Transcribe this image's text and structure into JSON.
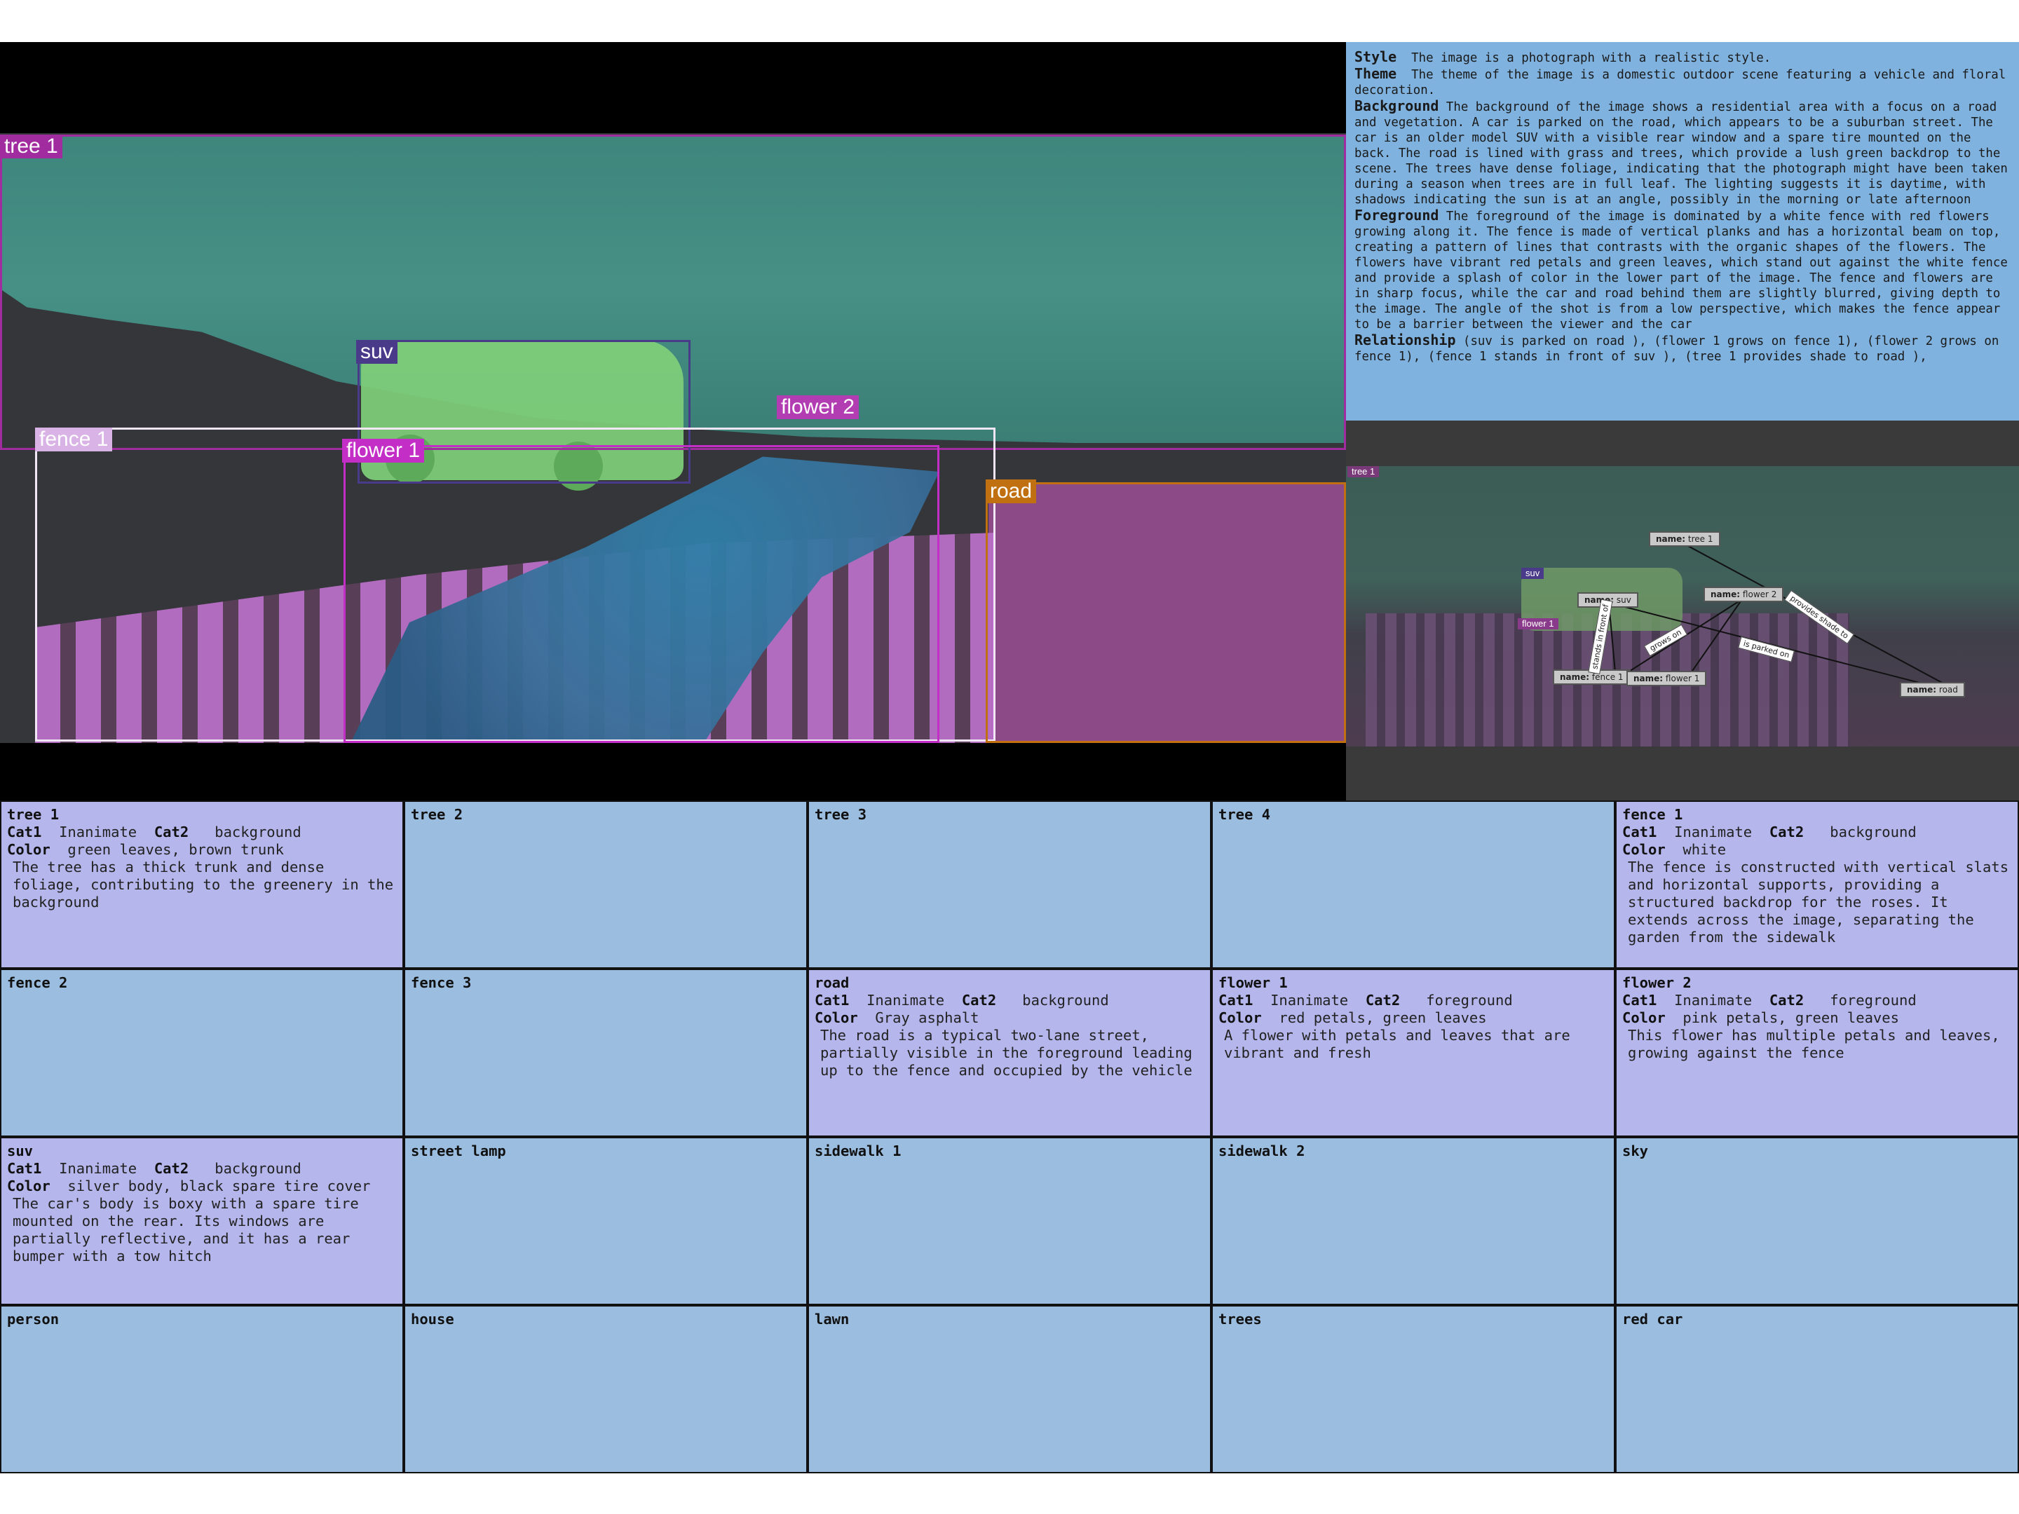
{
  "scene": {
    "labels": {
      "tree1": "tree 1",
      "suv": "suv",
      "flower2": "flower 2",
      "fence1": "fence 1",
      "flower1": "flower 1",
      "road": "road"
    },
    "colors": {
      "tree": "#1c8a78",
      "suv": "#4a3a8a",
      "flower2": "#b23cb2",
      "fence": "#ffffff",
      "flower1": "#c32ec6",
      "road": "#c07010"
    }
  },
  "description": {
    "style_key": "Style",
    "style": "The image is a photograph with a realistic style.",
    "theme_key": "Theme",
    "theme": "The theme of the image is a domestic outdoor scene featuring a vehicle and floral decoration.",
    "background_key": "Background",
    "background": "The background of the image shows a residential area with a focus on a road and vegetation. A car is parked on the road, which appears to be a suburban street. The car is an older model SUV with a visible rear window and a spare tire mounted on the back. The road is lined with grass and trees, which provide a lush green backdrop to the scene. The trees have dense foliage, indicating that the photograph might have been taken during a season when trees are in full leaf. The lighting suggests it is daytime, with shadows indicating the sun is at an angle, possibly in the morning or late afternoon",
    "foreground_key": "Foreground",
    "foreground": "The foreground of the image is dominated by a white fence with red flowers growing along it. The fence is made of vertical planks and has a horizontal beam on top, creating a pattern of lines that contrasts with the organic shapes of the flowers. The flowers have vibrant red petals and green leaves, which stand out against the white fence and provide a splash of color in the lower part of the image. The fence and flowers are in sharp focus, while the car and road behind them are slightly blurred, giving depth to the image. The angle of the shot is from a low perspective, which makes the fence appear to be a barrier between the viewer and the car",
    "relationship_key": "Relationship",
    "relationship": "(suv  is parked on road ), (flower 1 grows on fence 1), (flower 2  grows on fence 1), (fence 1 stands in front of suv ), (tree 1 provides shade to road ),"
  },
  "graph": {
    "thumb_labels": {
      "tree1": "tree 1",
      "suv": "suv",
      "flower1": "flower 1"
    },
    "name_key": "name:",
    "nodes": {
      "tree1": "tree 1",
      "suv": "suv",
      "flower2": "flower 2",
      "fence1": "fence 1",
      "flower1": "flower 1",
      "road": "road"
    },
    "edges": {
      "shade": "provides shade to",
      "parked": "is parked on",
      "grows": "grows on",
      "front": "stands in front of"
    }
  },
  "keys": {
    "cat1": "Cat1",
    "cat2": "Cat2",
    "color": "Color"
  },
  "cells": [
    {
      "title": "tree 1",
      "cat1": "Inanimate",
      "cat2": "background",
      "color": "green leaves, brown trunk",
      "desc": "The tree has a thick trunk and dense foliage, contributing to the greenery in the background"
    },
    {
      "title": "tree 2"
    },
    {
      "title": "tree 3"
    },
    {
      "title": "tree 4"
    },
    {
      "title": "fence 1",
      "cat1": "Inanimate",
      "cat2": "background",
      "color": "white",
      "desc": "The fence is constructed with vertical slats and horizontal supports, providing a structured backdrop for the roses. It extends across the image, separating the garden from the sidewalk"
    },
    {
      "title": "fence 2"
    },
    {
      "title": "fence 3"
    },
    {
      "title": "road",
      "cat1": "Inanimate",
      "cat2": "background",
      "color": "Gray asphalt",
      "desc": "The road is a typical two-lane street, partially visible in the foreground leading up to the fence and occupied by the vehicle"
    },
    {
      "title": "flower 1",
      "cat1": "Inanimate",
      "cat2": "foreground",
      "color": "red petals, green leaves",
      "desc": "A flower with petals and leaves that are vibrant and fresh"
    },
    {
      "title": "flower 2",
      "cat1": "Inanimate",
      "cat2": "foreground",
      "color": "pink petals, green leaves",
      "desc": "This flower has multiple petals and leaves, growing against the fence"
    },
    {
      "title": "suv",
      "cat1": "Inanimate",
      "cat2": "background",
      "color": "silver body, black spare tire cover",
      "desc": "The car's body is boxy with a spare tire mounted on the rear. Its windows are partially reflective, and it has a rear bumper with a tow hitch"
    },
    {
      "title": "street lamp"
    },
    {
      "title": "sidewalk 1"
    },
    {
      "title": "sidewalk 2"
    },
    {
      "title": "sky"
    },
    {
      "title": "person"
    },
    {
      "title": "house"
    },
    {
      "title": "lawn"
    },
    {
      "title": "trees"
    },
    {
      "title": "red car"
    }
  ]
}
